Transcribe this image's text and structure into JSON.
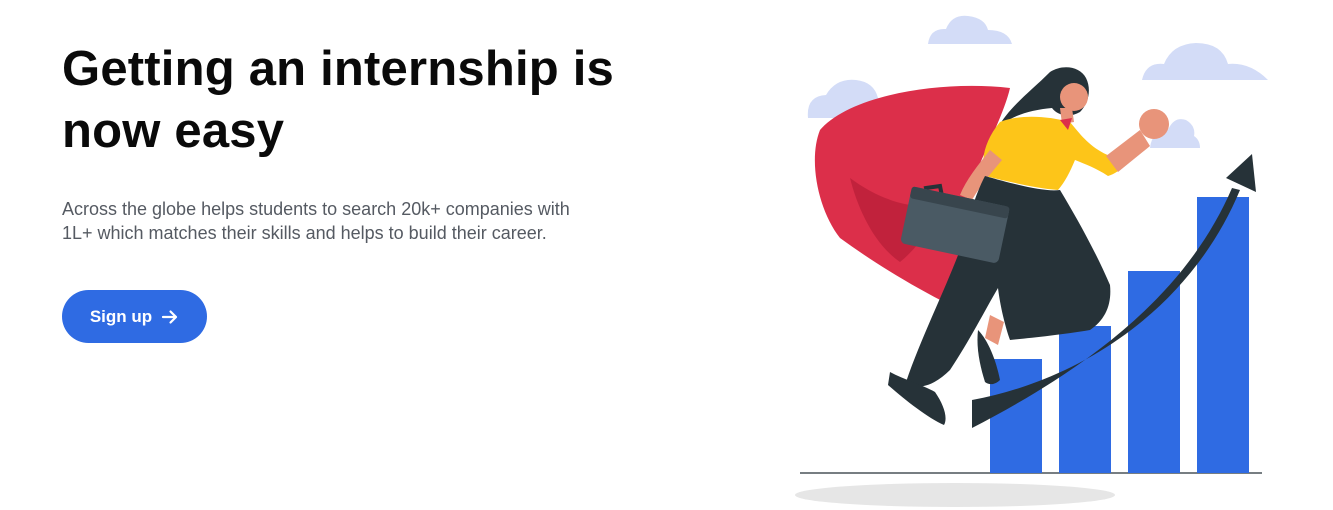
{
  "hero": {
    "title_line1": "Getting an internship is",
    "title_line2": "now easy",
    "description_line1": "Across the globe helps students to search 20k+ companies with",
    "description_line2": "1L+ which matches their skills and helps to build their career.",
    "cta_label": "Sign up",
    "cta_icon": "arrow-right-icon"
  },
  "illustration": {
    "subject": "superhero-woman-growth-chart",
    "colors": {
      "bars": "#2f6be3",
      "cape": "#dc2f4a",
      "shirt": "#fdc519",
      "clouds": "#d3dcf7",
      "dark": "#263238",
      "skin": "#e8947a"
    }
  }
}
